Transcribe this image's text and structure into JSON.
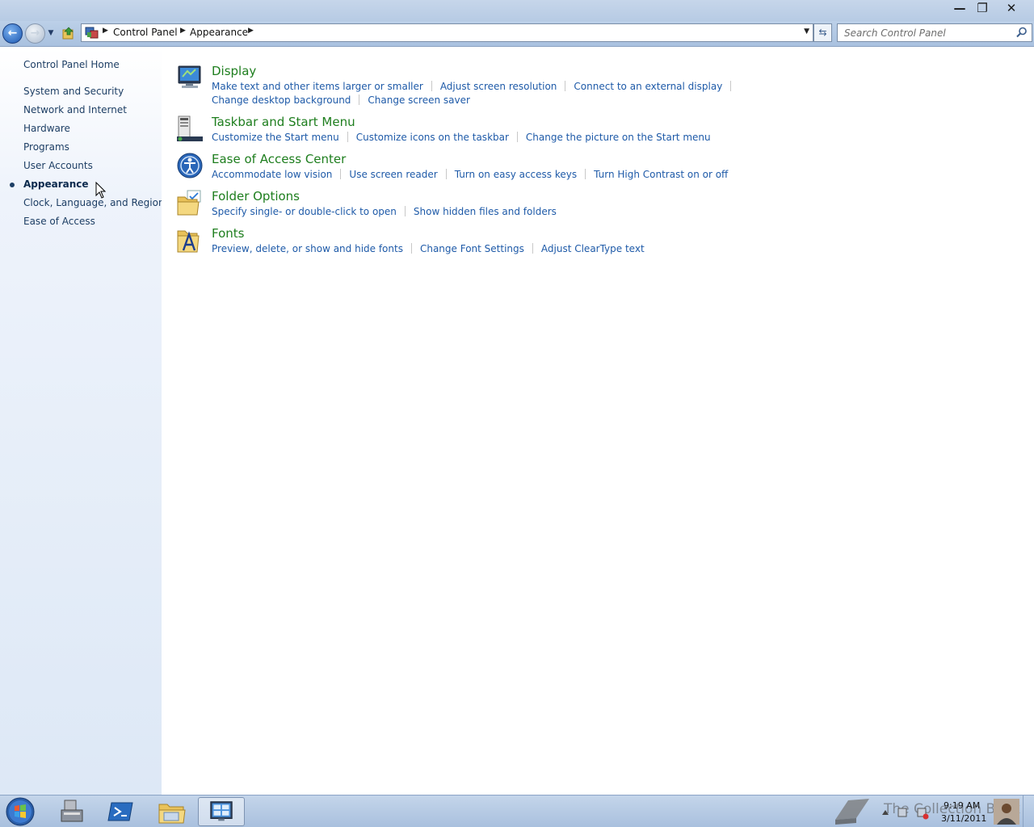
{
  "window": {
    "minimize": "—",
    "maximize": "❐",
    "close": "✕"
  },
  "nav": {
    "back_glyph": "←",
    "forward_glyph": "→",
    "recent_glyph": "▼",
    "breadcrumbs": [
      "Control Panel",
      "Appearance"
    ],
    "crumb_separator": "▶",
    "dropdown_glyph": "▼",
    "refresh_glyph": "⇆",
    "search_placeholder": "Search Control Panel"
  },
  "sidebar": {
    "items": [
      {
        "label": "Control Panel Home",
        "current": false
      },
      {
        "label": "System and Security",
        "current": false
      },
      {
        "label": "Network and Internet",
        "current": false
      },
      {
        "label": "Hardware",
        "current": false
      },
      {
        "label": "Programs",
        "current": false
      },
      {
        "label": "User Accounts",
        "current": false
      },
      {
        "label": "Appearance",
        "current": true
      },
      {
        "label": "Clock, Language, and Region",
        "current": false
      },
      {
        "label": "Ease of Access",
        "current": false
      }
    ]
  },
  "categories": [
    {
      "title": "Display",
      "icon": "display-icon",
      "rows": [
        [
          "Make text and other items larger or smaller",
          "Adjust screen resolution",
          "Connect to an external display"
        ],
        [
          "Change desktop background",
          "Change screen saver"
        ]
      ]
    },
    {
      "title": "Taskbar and Start Menu",
      "icon": "taskbar-icon",
      "rows": [
        [
          "Customize the Start menu",
          "Customize icons on the taskbar",
          "Change the picture on the Start menu"
        ]
      ]
    },
    {
      "title": "Ease of Access Center",
      "icon": "ease-of-access-icon",
      "rows": [
        [
          "Accommodate low vision",
          "Use screen reader",
          "Turn on easy access keys",
          "Turn High Contrast on or off"
        ]
      ]
    },
    {
      "title": "Folder Options",
      "icon": "folder-options-icon",
      "rows": [
        [
          "Specify single- or double-click to open",
          "Show hidden files and folders"
        ]
      ]
    },
    {
      "title": "Fonts",
      "icon": "fonts-icon",
      "rows": [
        [
          "Preview, delete, or show and hide fonts",
          "Change Font Settings",
          "Adjust ClearType text"
        ]
      ]
    }
  ],
  "taskbar": {
    "watermark": "The Collection Book",
    "time": "9:19 AM",
    "date": "3/11/2011"
  },
  "colors": {
    "link": "#1e5aa8",
    "category_title": "#1e7e1e",
    "sidebar_text": "#1d3e64"
  }
}
